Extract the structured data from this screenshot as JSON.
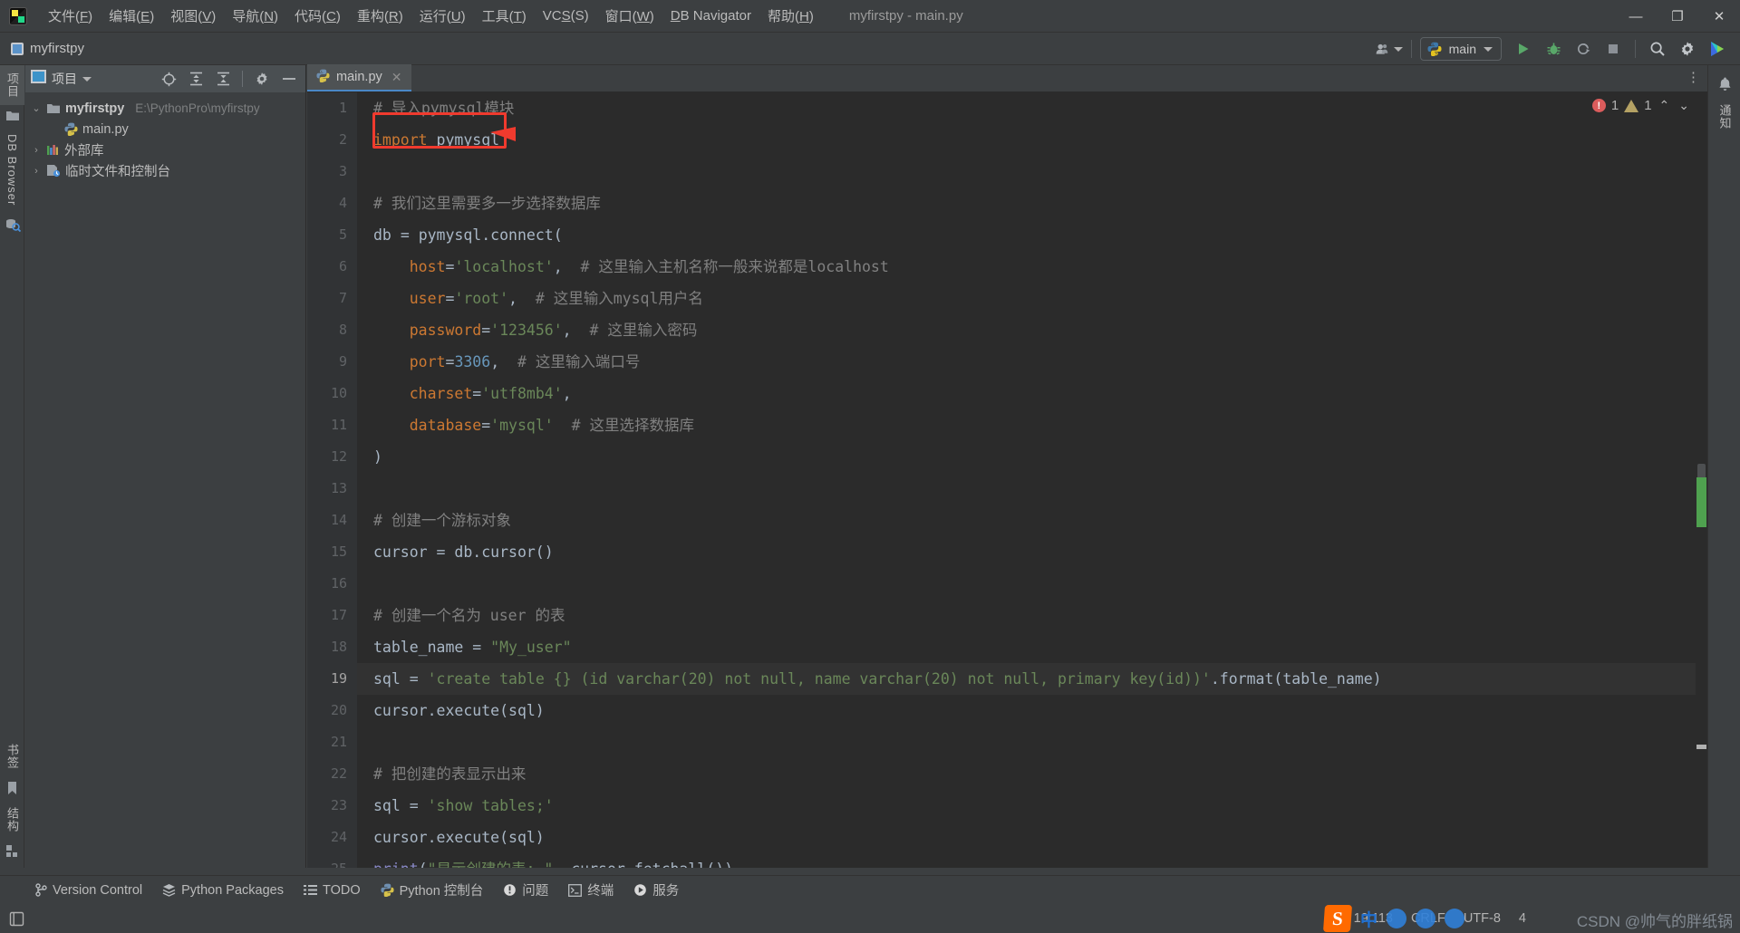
{
  "window": {
    "title": "myfirstpy - main.py",
    "controls": {
      "minimize": "—",
      "maximize": "❐",
      "close": "✕"
    }
  },
  "menubar": {
    "items": [
      {
        "label": "文件(F)",
        "mnemonic": "F"
      },
      {
        "label": "编辑(E)",
        "mnemonic": "E"
      },
      {
        "label": "视图(V)",
        "mnemonic": "V"
      },
      {
        "label": "导航(N)",
        "mnemonic": "N"
      },
      {
        "label": "代码(C)",
        "mnemonic": "C"
      },
      {
        "label": "重构(R)",
        "mnemonic": "R"
      },
      {
        "label": "运行(U)",
        "mnemonic": "U"
      },
      {
        "label": "工具(T)",
        "mnemonic": "T"
      },
      {
        "label": "VCS(S)",
        "mnemonic": "S"
      },
      {
        "label": "窗口(W)",
        "mnemonic": "W"
      },
      {
        "label": "DB Navigator",
        "mnemonic": "D"
      },
      {
        "label": "帮助(H)",
        "mnemonic": "H"
      }
    ]
  },
  "navbar": {
    "project_name": "myfirstpy",
    "run_config": "main",
    "icons": {
      "user": "users-icon",
      "run": "run-icon",
      "debug": "debug-icon",
      "coverage": "coverage-icon",
      "stop": "stop-icon",
      "search": "search-icon",
      "settings": "gear-icon",
      "ai": "ai-assistant-icon"
    }
  },
  "left_rail": {
    "top": [
      {
        "label": "项目",
        "icon": "project-icon",
        "selected": true
      },
      {
        "label": "",
        "icon": "folder-icon",
        "selected": false
      },
      {
        "label": "DB Browser",
        "icon": "db-browser-icon",
        "selected": false
      }
    ],
    "bottom": [
      {
        "label": "书签",
        "icon": "bookmark-icon"
      },
      {
        "label": "结构",
        "icon": "structure-icon"
      }
    ]
  },
  "right_rail": {
    "items": [
      {
        "label": "通知",
        "icon": "bell-icon"
      }
    ]
  },
  "project_panel": {
    "title": "项目",
    "toolbar_icons": [
      "locate-icon",
      "expand-all-icon",
      "collapse-all-icon",
      "gear-icon",
      "hide-icon"
    ],
    "tree": [
      {
        "label": "myfirstpy",
        "path": "E:\\PythonPro\\myfirstpy",
        "icon": "folder-icon",
        "depth": 0,
        "arrow": "⌄",
        "bold": true
      },
      {
        "label": "main.py",
        "path": "",
        "icon": "python-file-icon",
        "depth": 1,
        "arrow": "",
        "bold": false
      },
      {
        "label": "外部库",
        "path": "",
        "icon": "library-icon",
        "depth": 0,
        "arrow": "›",
        "bold": false
      },
      {
        "label": "临时文件和控制台",
        "path": "",
        "icon": "scratch-icon",
        "depth": 0,
        "arrow": "›",
        "bold": false
      }
    ]
  },
  "editor": {
    "tab": {
      "label": "main.py",
      "icon": "python-file-icon",
      "close": "✕"
    },
    "inspection": {
      "errors": "1",
      "warnings": "1",
      "up": "⌃",
      "down": "⌄"
    },
    "lines": [
      {
        "n": "1",
        "tokens": [
          {
            "t": "# 导入pymysql模块",
            "c": "cmt"
          }
        ]
      },
      {
        "n": "2",
        "tokens": [
          {
            "t": "import",
            "c": "kw"
          },
          {
            "t": " pymysql",
            "c": "plain"
          }
        ]
      },
      {
        "n": "3",
        "tokens": []
      },
      {
        "n": "4",
        "tokens": [
          {
            "t": "# 我们这里需要多一步选择数据库",
            "c": "cmt"
          }
        ]
      },
      {
        "n": "5",
        "tokens": [
          {
            "t": "db ",
            "c": "plain"
          },
          {
            "t": "= ",
            "c": "plain"
          },
          {
            "t": "pymysql.connect(",
            "c": "plain"
          }
        ]
      },
      {
        "n": "6",
        "tokens": [
          {
            "t": "    ",
            "c": "plain"
          },
          {
            "t": "host",
            "c": "kw"
          },
          {
            "t": "=",
            "c": "plain"
          },
          {
            "t": "'localhost'",
            "c": "str"
          },
          {
            "t": ",  ",
            "c": "plain"
          },
          {
            "t": "# 这里输入主机名称一般来说都是localhost",
            "c": "cmt"
          }
        ]
      },
      {
        "n": "7",
        "tokens": [
          {
            "t": "    ",
            "c": "plain"
          },
          {
            "t": "user",
            "c": "kw"
          },
          {
            "t": "=",
            "c": "plain"
          },
          {
            "t": "'root'",
            "c": "str"
          },
          {
            "t": ",  ",
            "c": "plain"
          },
          {
            "t": "# 这里输入mysql用户名",
            "c": "cmt"
          }
        ]
      },
      {
        "n": "8",
        "tokens": [
          {
            "t": "    ",
            "c": "plain"
          },
          {
            "t": "password",
            "c": "kw"
          },
          {
            "t": "=",
            "c": "plain"
          },
          {
            "t": "'123456'",
            "c": "str"
          },
          {
            "t": ",  ",
            "c": "plain"
          },
          {
            "t": "# 这里输入密码",
            "c": "cmt"
          }
        ]
      },
      {
        "n": "9",
        "tokens": [
          {
            "t": "    ",
            "c": "plain"
          },
          {
            "t": "port",
            "c": "kw"
          },
          {
            "t": "=",
            "c": "plain"
          },
          {
            "t": "3306",
            "c": "num"
          },
          {
            "t": ",  ",
            "c": "plain"
          },
          {
            "t": "# 这里输入端口号",
            "c": "cmt"
          }
        ]
      },
      {
        "n": "10",
        "tokens": [
          {
            "t": "    ",
            "c": "plain"
          },
          {
            "t": "charset",
            "c": "kw"
          },
          {
            "t": "=",
            "c": "plain"
          },
          {
            "t": "'utf8mb4'",
            "c": "str"
          },
          {
            "t": ",",
            "c": "plain"
          }
        ]
      },
      {
        "n": "11",
        "tokens": [
          {
            "t": "    ",
            "c": "plain"
          },
          {
            "t": "database",
            "c": "kw"
          },
          {
            "t": "=",
            "c": "plain"
          },
          {
            "t": "'mysql'",
            "c": "str"
          },
          {
            "t": "  ",
            "c": "plain"
          },
          {
            "t": "# 这里选择数据库",
            "c": "cmt"
          }
        ]
      },
      {
        "n": "12",
        "tokens": [
          {
            "t": ")",
            "c": "plain"
          }
        ]
      },
      {
        "n": "13",
        "tokens": []
      },
      {
        "n": "14",
        "tokens": [
          {
            "t": "# 创建一个游标对象",
            "c": "cmt"
          }
        ]
      },
      {
        "n": "15",
        "tokens": [
          {
            "t": "cursor = db.cursor()",
            "c": "plain"
          }
        ]
      },
      {
        "n": "16",
        "tokens": []
      },
      {
        "n": "17",
        "tokens": [
          {
            "t": "# 创建一个名为 user 的表",
            "c": "cmt"
          }
        ]
      },
      {
        "n": "18",
        "tokens": [
          {
            "t": "table_name = ",
            "c": "plain"
          },
          {
            "t": "\"My_user\"",
            "c": "str"
          }
        ]
      },
      {
        "n": "19",
        "tokens": [
          {
            "t": "sql = ",
            "c": "plain"
          },
          {
            "t": "'create table {} (id varchar(20) not null, name varchar(20) not null, primary key(id))'",
            "c": "str"
          },
          {
            "t": ".format(table_name)",
            "c": "plain"
          }
        ],
        "highlight": true
      },
      {
        "n": "20",
        "tokens": [
          {
            "t": "cursor.execute(sql)",
            "c": "plain"
          }
        ]
      },
      {
        "n": "21",
        "tokens": []
      },
      {
        "n": "22",
        "tokens": [
          {
            "t": "# 把创建的表显示出来",
            "c": "cmt"
          }
        ]
      },
      {
        "n": "23",
        "tokens": [
          {
            "t": "sql = ",
            "c": "plain"
          },
          {
            "t": "'show tables;'",
            "c": "str"
          }
        ]
      },
      {
        "n": "24",
        "tokens": [
          {
            "t": "cursor.execute(sql)",
            "c": "plain"
          }
        ]
      },
      {
        "n": "25",
        "tokens": [
          {
            "t": "print",
            "c": "bi"
          },
          {
            "t": "(",
            "c": "plain"
          },
          {
            "t": "\"显示创建的表: \"",
            "c": "str"
          },
          {
            "t": ", cursor.fetchall())",
            "c": "plain"
          }
        ]
      }
    ]
  },
  "annotation": {
    "box_target": "pymysql",
    "color": "#f03a2e",
    "arrow": "left-pointing-arrow"
  },
  "bottom_bar": {
    "items": [
      {
        "label": "Version Control",
        "icon": "branch-icon"
      },
      {
        "label": "Python Packages",
        "icon": "packages-icon"
      },
      {
        "label": "TODO",
        "icon": "todo-icon"
      },
      {
        "label": "Python 控制台",
        "icon": "python-console-icon"
      },
      {
        "label": "问题",
        "icon": "problems-icon"
      },
      {
        "label": "终端",
        "icon": "terminal-icon"
      },
      {
        "label": "服务",
        "icon": "services-icon"
      }
    ]
  },
  "status_bar": {
    "left_icon": "layout-icon",
    "caret_position": "19:113",
    "line_separator": "CRLF",
    "encoding": "UTF-8",
    "indent": "4",
    "ime_logo": "S",
    "ime_mode": "中",
    "watermark": "CSDN @帅气的胖纸锅"
  }
}
